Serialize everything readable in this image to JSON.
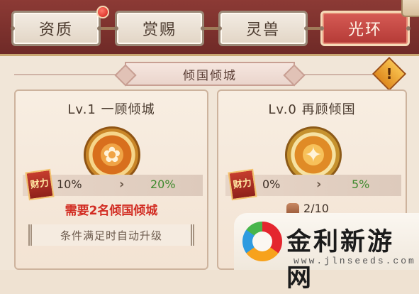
{
  "tabs": [
    {
      "label": "资质",
      "active": false,
      "has_notification": true
    },
    {
      "label": "赏赐",
      "active": false,
      "has_notification": false
    },
    {
      "label": "灵兽",
      "active": false,
      "has_notification": false
    },
    {
      "label": "光环",
      "active": true,
      "has_notification": false
    }
  ],
  "header": {
    "title": "倾国倾城",
    "info_label": "!"
  },
  "cards": [
    {
      "title": "Lv.1 一顾倾城",
      "medal_icon": "flower-medal-icon",
      "stat_label": "财力",
      "current": "10%",
      "next": "20%",
      "requirement": "需要2名倾国倾城",
      "auto_upgrade": "条件满足时自动升级"
    },
    {
      "title": "Lv.0 再顾倾国",
      "medal_icon": "ornate-medal-icon",
      "stat_label": "财力",
      "current": "0%",
      "next": "5%",
      "cost_icon": "item-pouch-icon",
      "cost": "2/10"
    }
  ],
  "watermark": {
    "title": "金利新游网",
    "url": "www.jlnseeds.com"
  },
  "colors": {
    "accent": "#b43a36",
    "positive": "#3f8a2e",
    "warning": "#d22d23"
  }
}
